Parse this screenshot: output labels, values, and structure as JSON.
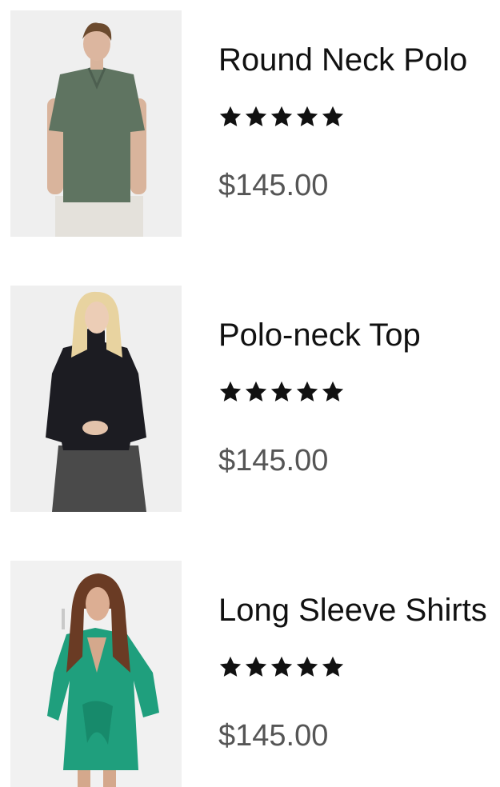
{
  "products": [
    {
      "name": "Round Neck Polo",
      "rating": 5,
      "rating_max": 5,
      "price": "$145.00",
      "image_icon": "product-photo-man-green-polo",
      "garment_color": "#5f7461"
    },
    {
      "name": "Polo-neck Top",
      "rating": 5,
      "rating_max": 5,
      "price": "$145.00",
      "image_icon": "product-photo-woman-black-turtleneck",
      "garment_color": "#1c1c22"
    },
    {
      "name": "Long Sleeve Shirts",
      "rating": 5,
      "rating_max": 5,
      "price": "$145.00",
      "image_icon": "product-photo-woman-green-dress",
      "garment_color": "#1f9f7d"
    }
  ],
  "colors": {
    "star": "#111111",
    "price": "#555555",
    "thumb_bg": "#eeeeee"
  }
}
